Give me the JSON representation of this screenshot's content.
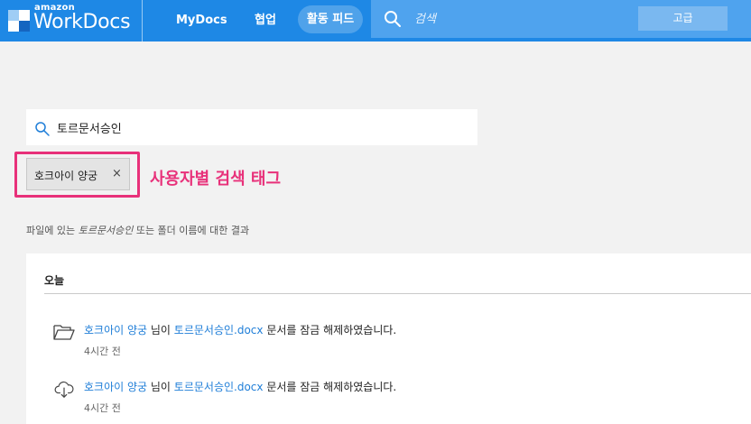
{
  "header": {
    "logo_top": "amazon",
    "logo_name": "WorkDocs",
    "nav": {
      "mydocs": "MyDocs",
      "collab": "협업",
      "feed": "활동 피드"
    },
    "search_placeholder": "검색",
    "advanced_label": "고급"
  },
  "search": {
    "query": "토르문서승인"
  },
  "tag": {
    "label": "호크아이 양궁",
    "close": "×",
    "annotation": "사용자별 검색 태그"
  },
  "result_info": {
    "prefix": "파일에 있는 ",
    "query": "토르문서승인",
    "suffix": " 또는 폴더 이름에 대한 결과"
  },
  "section": {
    "title": "오늘"
  },
  "activities": [
    {
      "icon": "folder-open-icon",
      "user": "호크아이 양궁",
      "connector": " 님이 ",
      "file": "토르문서승인.docx",
      "action": " 문서를 잠금 해제하였습니다.",
      "time": "4시간 전"
    },
    {
      "icon": "cloud-download-icon",
      "user": "호크아이 양궁",
      "connector": " 님이 ",
      "file": "토르문서승인.docx",
      "action": " 문서를 잠금 해제하였습니다.",
      "time": "4시간 전"
    }
  ],
  "colors": {
    "header": "#1e88e5",
    "search_bar": "#4fa3ee",
    "advanced_button": "#7ab8f0",
    "link": "#1f7ed8",
    "annotation": "#e8317a"
  }
}
